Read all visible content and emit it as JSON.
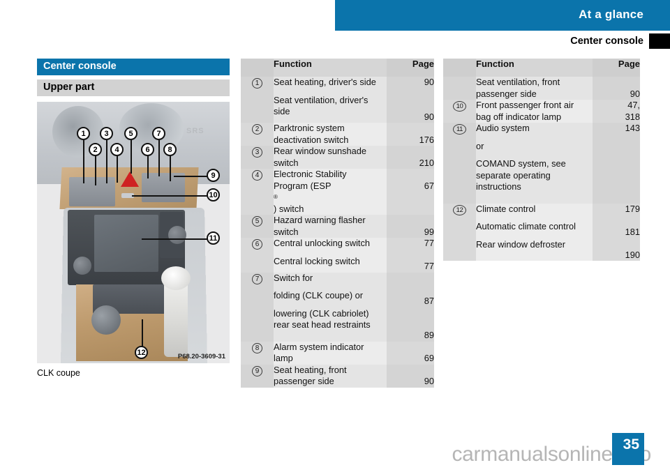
{
  "header": {
    "chapter_title": "At a glance",
    "section_title": "Center console"
  },
  "left": {
    "blue_heading": "Center console",
    "gray_heading": "Upper part",
    "photo_caption": "CLK coupe",
    "image_code": "P68.20-3609-31",
    "srs_label": "SRS",
    "callouts": [
      "1",
      "2",
      "3",
      "4",
      "5",
      "6",
      "7",
      "8",
      "9",
      "10",
      "11",
      "12"
    ]
  },
  "tables": [
    {
      "id": "middle",
      "columns": {
        "num": "",
        "function": "Function",
        "page": "Page"
      },
      "rows": [
        {
          "num": "1",
          "lines": [
            "Seat heating, driver's side",
            "",
            "Seat ventilation, driver's",
            "side"
          ],
          "pages": [
            "90",
            "",
            "",
            "90"
          ]
        },
        {
          "num": "2",
          "lines": [
            "Parktronic system",
            "deactivation switch"
          ],
          "pages": [
            "",
            "176"
          ]
        },
        {
          "num": "3",
          "lines": [
            "Rear window sunshade",
            "switch"
          ],
          "pages": [
            "",
            "210"
          ]
        },
        {
          "num": "4",
          "lines": [
            "Electronic Stability",
            "Program (ESP®) switch"
          ],
          "pages": [
            "",
            "67"
          ]
        },
        {
          "num": "5",
          "lines": [
            "Hazard warning flasher",
            "switch"
          ],
          "pages": [
            "",
            "99"
          ]
        },
        {
          "num": "6",
          "lines": [
            "Central unlocking switch",
            "",
            "Central locking switch"
          ],
          "pages": [
            "77",
            "",
            "77"
          ]
        },
        {
          "num": "7",
          "lines": [
            "Switch for",
            "",
            "folding (CLK coupe) or",
            "",
            "lowering (CLK cabriolet)",
            "rear seat head restraints"
          ],
          "pages": [
            "",
            "",
            "87",
            "",
            "",
            "89"
          ]
        },
        {
          "num": "8",
          "lines": [
            "Alarm system indicator",
            "lamp"
          ],
          "pages": [
            "",
            "69"
          ]
        },
        {
          "num": "9",
          "lines": [
            "Seat heating, front",
            "passenger side"
          ],
          "pages": [
            "",
            "90"
          ]
        }
      ]
    },
    {
      "id": "right",
      "columns": {
        "num": "",
        "function": "Function",
        "page": "Page"
      },
      "rows": [
        {
          "num": "",
          "lines": [
            "Seat ventilation, front",
            "passenger side"
          ],
          "pages": [
            "",
            "90"
          ]
        },
        {
          "num": "10",
          "lines": [
            "Front passenger front air",
            "bag off indicator lamp"
          ],
          "pages": [
            "47,",
            "318"
          ]
        },
        {
          "num": "11",
          "lines": [
            "Audio system",
            "",
            "or",
            "",
            "COMAND system, see",
            "separate operating",
            "instructions"
          ],
          "pages": [
            "143",
            "",
            "",
            "",
            "",
            "",
            ""
          ]
        },
        {
          "num": "12",
          "lines": [
            "Climate control",
            "",
            "Automatic climate control",
            "",
            "Rear window defroster"
          ],
          "pages": [
            "179",
            "",
            "181",
            "",
            "190"
          ]
        }
      ]
    }
  ],
  "footer": {
    "page_number": "35",
    "watermark": "carmanualsonline.info"
  },
  "colors": {
    "brand_blue": "#0b74ab",
    "gray_heading": "#d2d2d2",
    "table_header": "#d6d6d6",
    "row_light": "#e4e4e4",
    "row_alt": "#ececec",
    "num_col": "#d4d4d4"
  }
}
